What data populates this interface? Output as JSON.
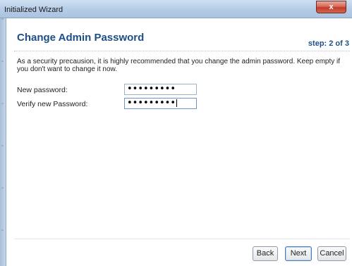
{
  "window": {
    "title": "Initialized Wizard",
    "close_label": "x"
  },
  "page": {
    "heading": "Change Admin Password",
    "step": "step: 2 of 3",
    "description": "As a security precausion, it is highly recommended that you change the admin password. Keep empty if you don't want to change it now."
  },
  "form": {
    "new_password_label": "New password:",
    "new_password_value": "•••••••••",
    "verify_password_label": "Verify new Password:",
    "verify_password_value": "•••••••••"
  },
  "buttons": {
    "back": "Back",
    "next": "Next",
    "cancel": "Cancel"
  },
  "colors": {
    "heading": "#1d4f87",
    "close": "#c23b2a"
  }
}
